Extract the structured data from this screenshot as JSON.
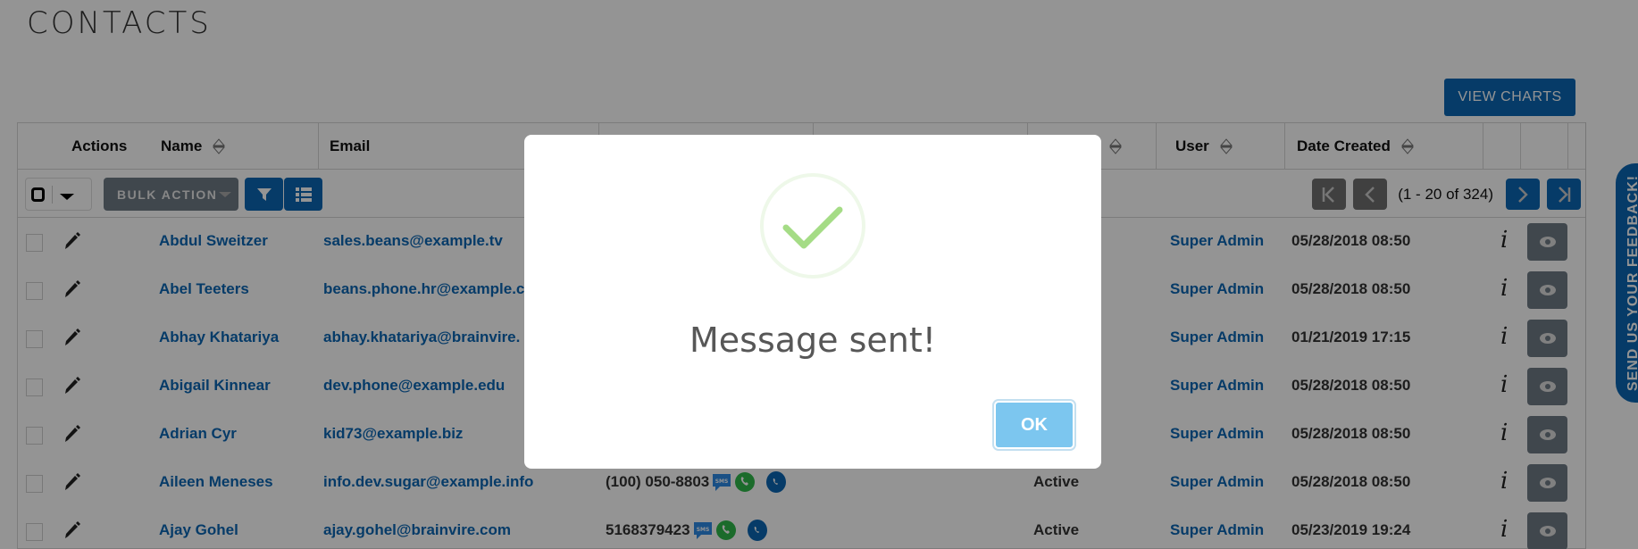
{
  "page": {
    "title": "CONTACTS",
    "view_charts_label": "VIEW CHARTS"
  },
  "table": {
    "headers": {
      "actions": "Actions",
      "name": "Name",
      "email": "Email",
      "user": "User",
      "date_created": "Date Created"
    },
    "toolbar": {
      "bulk_action_label": "BULK ACTION",
      "pagination_label": "(1 - 20 of 324)"
    },
    "rows": [
      {
        "name": "Abdul Sweitzer",
        "email": "sales.beans@example.tv",
        "phone": "",
        "status": "",
        "user": "Super Admin",
        "date": "05/28/2018 08:50"
      },
      {
        "name": "Abel Teeters",
        "email": "beans.phone.hr@example.co",
        "phone": "",
        "status": "",
        "user": "Super Admin",
        "date": "05/28/2018 08:50"
      },
      {
        "name": "Abhay Khatariya",
        "email": "abhay.khatariya@brainvire.",
        "phone": "",
        "status": "",
        "user": "Super Admin",
        "date": "01/21/2019 17:15"
      },
      {
        "name": "Abigail Kinnear",
        "email": "dev.phone@example.edu",
        "phone": "",
        "status": "",
        "user": "Super Admin",
        "date": "05/28/2018 08:50"
      },
      {
        "name": "Adrian Cyr",
        "email": "kid73@example.biz",
        "phone": "",
        "status": "",
        "user": "Super Admin",
        "date": "05/28/2018 08:50"
      },
      {
        "name": "Aileen Meneses",
        "email": "info.dev.sugar@example.info",
        "phone": "(100) 050-8803",
        "status": "Active",
        "user": "Super Admin",
        "date": "05/28/2018 08:50"
      },
      {
        "name": "Ajay Gohel",
        "email": "ajay.gohel@brainvire.com",
        "phone": "5168379423",
        "status": "Active",
        "user": "Super Admin",
        "date": "05/23/2019 19:24"
      }
    ],
    "info_glyph": "i",
    "sms_label": "SMS"
  },
  "feedback": {
    "label": "SEND US YOUR FEEDBACK!"
  },
  "modal": {
    "title": "Message sent!",
    "ok_label": "OK",
    "success_color": "#a5dc86"
  },
  "colors": {
    "primary": "#0b66b4",
    "dark_button": "#6e7a86",
    "ok_button": "#7cc6ef"
  }
}
